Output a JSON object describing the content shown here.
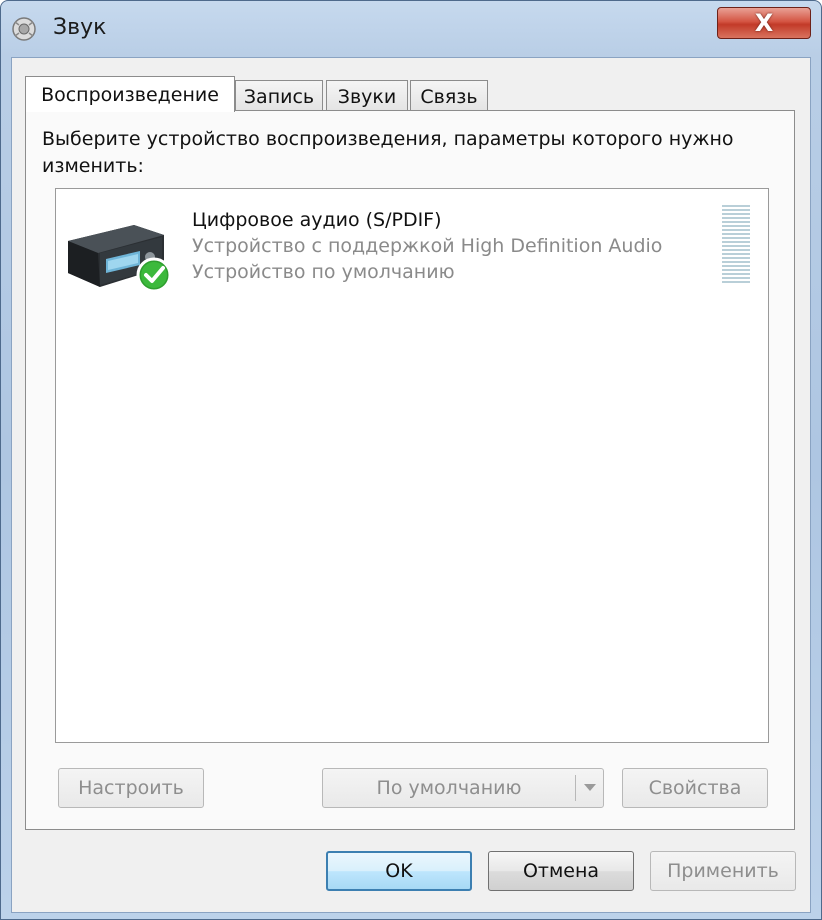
{
  "window": {
    "title": "Звук",
    "close_label": "X"
  },
  "tabs": [
    {
      "label": "Воспроизведение",
      "active": true
    },
    {
      "label": "Запись"
    },
    {
      "label": "Звуки"
    },
    {
      "label": "Связь"
    }
  ],
  "instruction": "Выберите устройство воспроизведения, параметры которого нужно изменить:",
  "devices": [
    {
      "name": "Цифровое аудио (S/PDIF)",
      "description": "Устройство с поддержкой High Definition Audio",
      "status": "Устройство по умолчанию",
      "icon": "audio-device-icon",
      "badge_icon": "checkmark-icon",
      "level": 0
    }
  ],
  "buttons": {
    "configure": "Настроить",
    "set_default": "По умолчанию",
    "properties": "Свойства",
    "ok": "OK",
    "cancel": "Отмена",
    "apply": "Применить"
  }
}
